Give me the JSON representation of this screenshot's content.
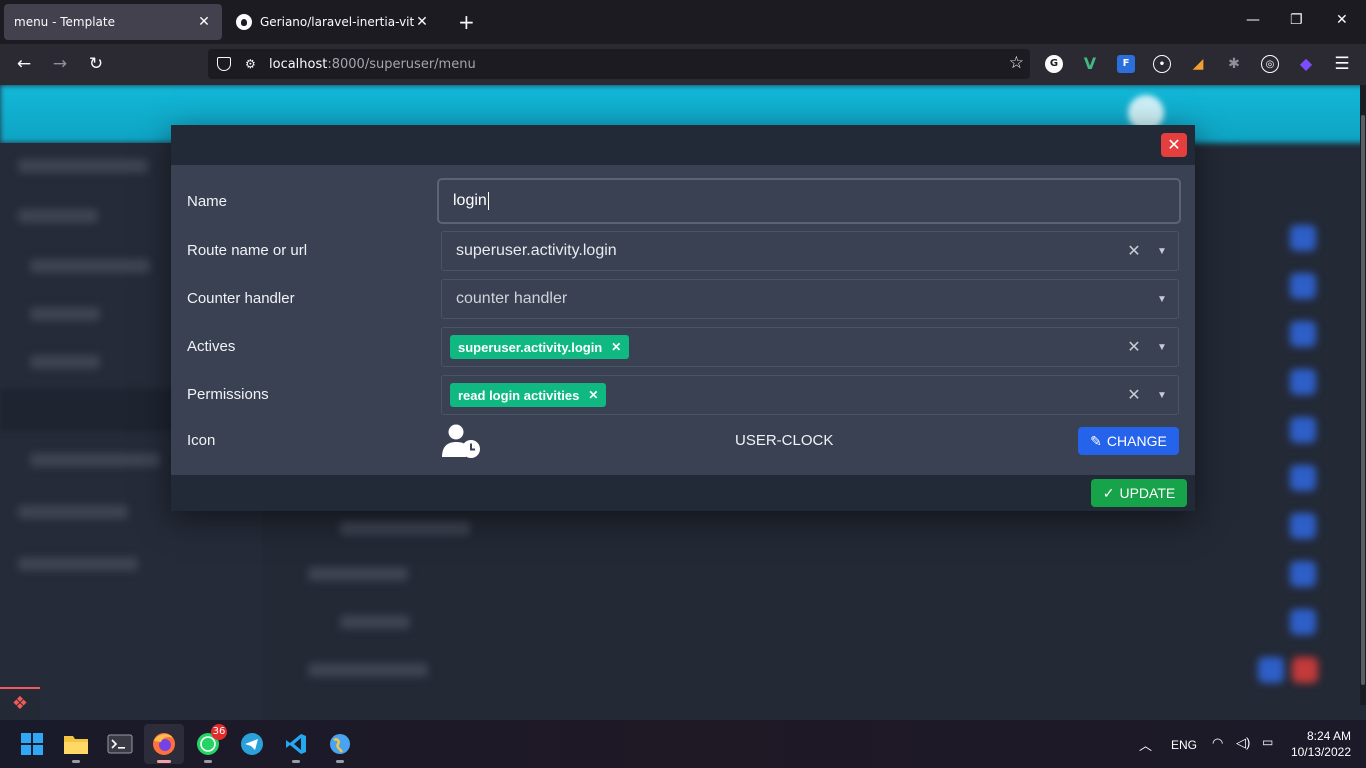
{
  "browser": {
    "tabs": [
      {
        "title": "menu - Template",
        "active": true
      },
      {
        "title": "Geriano/laravel-inertia-vite-tem",
        "active": false
      }
    ],
    "url_host": "localhost",
    "url_path": ":8000/superuser/menu"
  },
  "modal": {
    "fields": {
      "name": {
        "label": "Name",
        "value": "login"
      },
      "route": {
        "label": "Route name or url",
        "value": "superuser.activity.login"
      },
      "counter": {
        "label": "Counter handler",
        "placeholder": "counter handler"
      },
      "actives": {
        "label": "Actives",
        "tags": [
          "superuser.activity.login"
        ]
      },
      "permissions": {
        "label": "Permissions",
        "tags": [
          "read login activities"
        ]
      },
      "icon": {
        "label": "Icon",
        "name": "USER-CLOCK",
        "icon": "user-clock-icon"
      }
    },
    "change_label": "CHANGE",
    "update_label": "UPDATE"
  },
  "taskbar": {
    "whatsapp_badge": "36",
    "language": "ENG",
    "time": "8:24 AM",
    "date": "10/13/2022"
  },
  "colors": {
    "accent_cyan": "#12b8d8",
    "tag_green": "#10b981",
    "change_blue": "#2563eb",
    "update_green": "#16a34a",
    "close_red": "#e53e3e"
  }
}
